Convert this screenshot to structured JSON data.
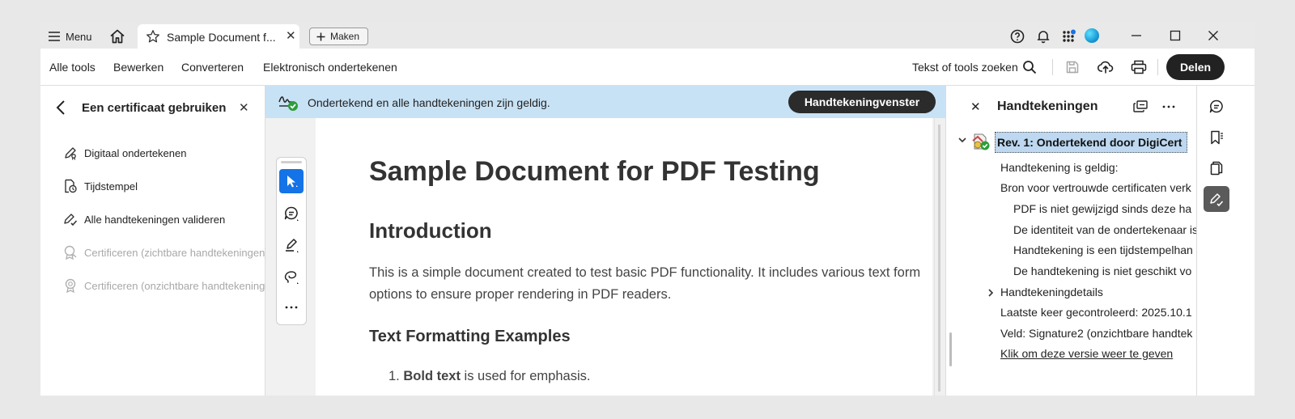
{
  "titlebar": {
    "menu_label": "Menu",
    "tab_title": "Sample Document f...",
    "make_label": "Maken"
  },
  "toolbar": {
    "items": [
      "Alle tools",
      "Bewerken",
      "Converteren",
      "Elektronisch ondertekenen"
    ],
    "search_label": "Tekst of tools zoeken",
    "share_label": "Delen"
  },
  "left_panel": {
    "title": "Een certificaat gebruiken",
    "items": [
      {
        "label": "Digitaal ondertekenen",
        "icon": "sign-digital-icon",
        "enabled": true
      },
      {
        "label": "Tijdstempel",
        "icon": "timestamp-icon",
        "enabled": true
      },
      {
        "label": "Alle handtekeningen valideren",
        "icon": "validate-signatures-icon",
        "enabled": true
      },
      {
        "label": "Certificeren (zichtbare handtekeningen)",
        "icon": "certify-visible-icon",
        "enabled": false
      },
      {
        "label": "Certificeren (onzichtbare handtekeningen)",
        "icon": "certify-invisible-icon",
        "enabled": false
      }
    ]
  },
  "banner": {
    "text": "Ondertekend en alle handtekeningen zijn geldig.",
    "button_label": "Handtekeningvenster",
    "background": "#c8e2f5"
  },
  "document": {
    "title": "Sample Document for PDF Testing",
    "heading_intro": "Introduction",
    "paragraph_line1": "This is a simple document created to test basic PDF functionality. It includes various text form",
    "paragraph_line2": "options to ensure proper rendering in PDF readers.",
    "heading_formatting": "Text Formatting Examples",
    "list_item_number": "1.",
    "list_item_bold": "Bold text",
    "list_item_rest": " is used for emphasis."
  },
  "signatures_panel": {
    "title": "Handtekeningen",
    "revision_label": "Rev. 1: Ondertekend door DigiCert",
    "lines": [
      "Handtekening is geldig:",
      "Bron voor vertrouwde certificaten verk",
      "PDF is niet gewijzigd sinds deze ha",
      "De identiteit van de ondertekenaar is",
      "Handtekening is een tijdstempelhan",
      "De handtekening is niet geschikt vo"
    ],
    "details_label": "Handtekeningdetails",
    "last_checked": "Laatste keer gecontroleerd: 2025.10.1",
    "field": "Veld: Signature2 (onzichtbare handtek",
    "view_version_link": "Klik om deze versie weer te geven"
  },
  "colors": {
    "accent": "#1473e6",
    "dark_button": "#222222",
    "selection": "#bdd8f0"
  }
}
